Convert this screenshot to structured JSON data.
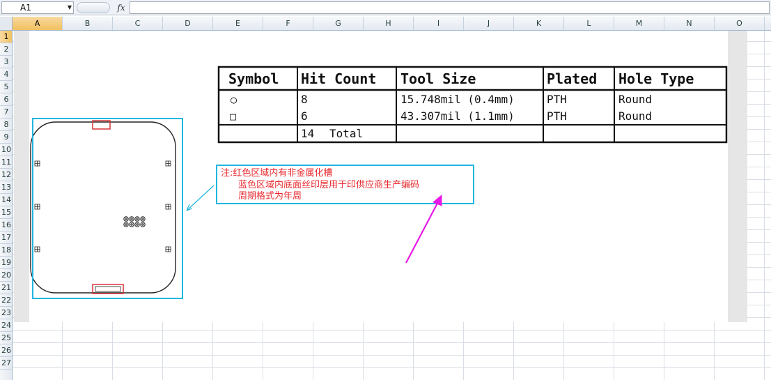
{
  "formula_bar": {
    "name_box": "A1",
    "fx_label": "fx",
    "formula": ""
  },
  "columns": [
    "A",
    "B",
    "C",
    "D",
    "E",
    "F",
    "G",
    "H",
    "I",
    "J",
    "K",
    "L",
    "M",
    "N",
    "O"
  ],
  "rows": [
    "1",
    "2",
    "3",
    "4",
    "5",
    "6",
    "7",
    "8",
    "9",
    "10",
    "11",
    "12",
    "13",
    "14",
    "15",
    "16",
    "17",
    "18",
    "19",
    "20",
    "21",
    "22",
    "23",
    "24",
    "25",
    "26",
    "27"
  ],
  "drill_table": {
    "headers": [
      "Symbol",
      "Hit Count",
      "Tool Size",
      "Plated",
      "Hole Type"
    ],
    "rows": [
      {
        "symbol": "○",
        "count": "8",
        "size": "15.748mil (0.4mm)",
        "plated": "PTH",
        "type": "Round"
      },
      {
        "symbol": "□",
        "count": "6",
        "size": "43.307mil (1.1mm)",
        "plated": "PTH",
        "type": "Round"
      }
    ],
    "total_count": "14",
    "total_label": "Total"
  },
  "note": {
    "line1": "注:红色区域内有非金属化槽",
    "line2": "蓝色区域内底面丝印层用于印供应商生产编码",
    "line3": "周期格式为年周"
  },
  "colors": {
    "note_red": "#e8282d",
    "highlight_cyan": "#1fb6e0",
    "arrow_magenta": "#e818e8",
    "slot_red": "#d6343a",
    "selection": "#f1c15f"
  }
}
